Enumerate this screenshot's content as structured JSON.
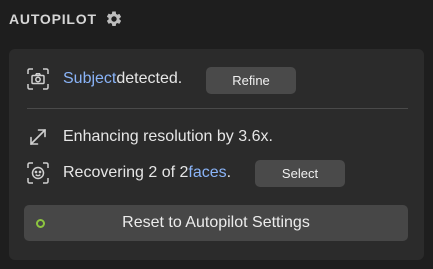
{
  "header": {
    "title": "AUTOPILOT",
    "settings_icon": "gear-icon"
  },
  "subject_row": {
    "icon": "camera-frame-icon",
    "highlight": "Subject",
    "text": " detected.",
    "button_label": "Refine"
  },
  "resolution_row": {
    "icon": "expand-arrows-icon",
    "text": "Enhancing resolution by 3.6x."
  },
  "faces_row": {
    "icon": "face-frame-icon",
    "prefix": "Recovering 2 of 2 ",
    "highlight": "faces",
    "suffix": ".",
    "button_label": "Select"
  },
  "reset": {
    "label": "Reset to Autopilot Settings",
    "indicator_color": "#8dc63f"
  },
  "colors": {
    "accent": "#8ab4f8",
    "background": "#1e1e1e",
    "panel": "#2b2b2b"
  }
}
